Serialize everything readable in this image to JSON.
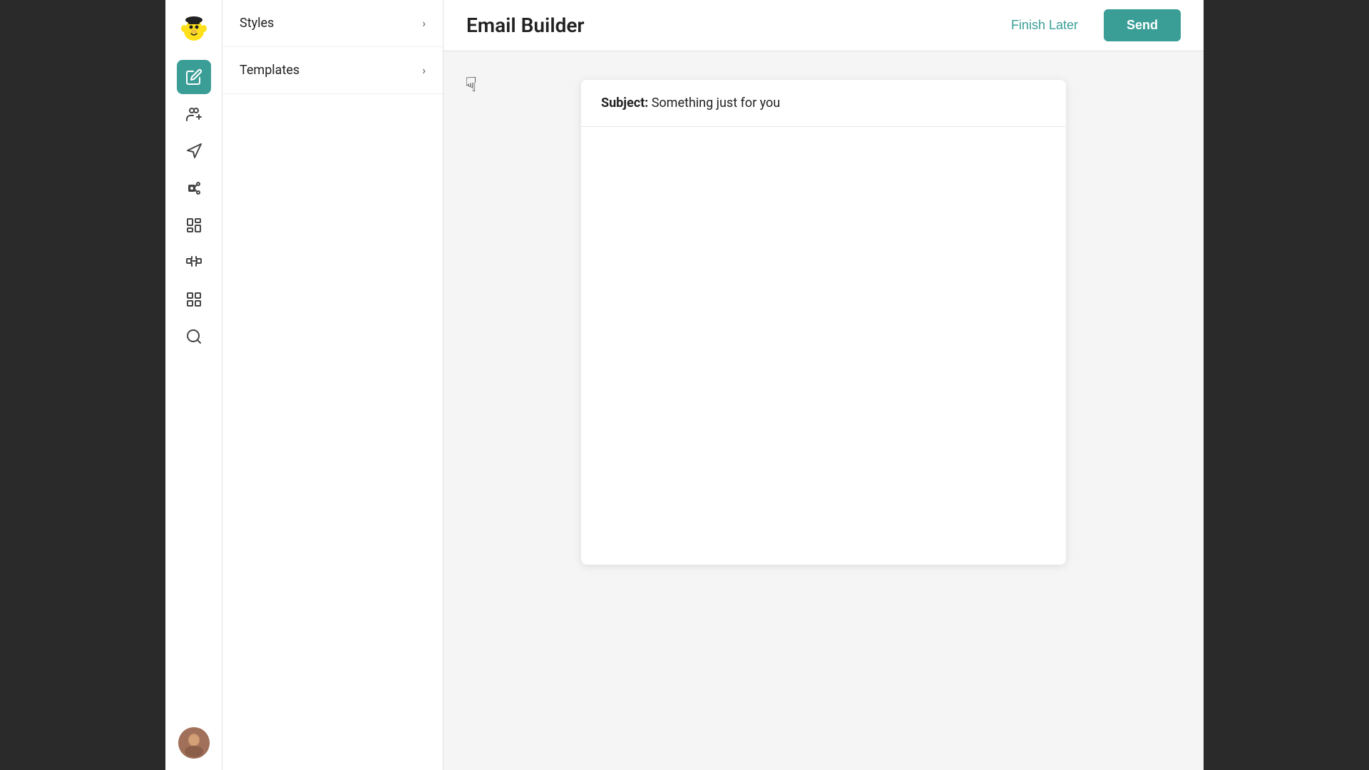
{
  "app": {
    "title": "Email Builder"
  },
  "header": {
    "finish_later_label": "Finish Later",
    "send_label": "Send"
  },
  "panel": {
    "styles_label": "Styles",
    "templates_label": "Templates"
  },
  "email": {
    "subject_label": "Subject:",
    "subject_text": "Something just for you"
  },
  "nav_icons": [
    {
      "name": "edit-icon",
      "label": "Edit",
      "active": true
    },
    {
      "name": "audience-icon",
      "label": "Audience",
      "active": false
    },
    {
      "name": "campaign-icon",
      "label": "Campaign",
      "active": false
    },
    {
      "name": "automation-icon",
      "label": "Automation",
      "active": false
    },
    {
      "name": "content-icon",
      "label": "Content",
      "active": false
    },
    {
      "name": "integrations-icon",
      "label": "Integrations",
      "active": false
    },
    {
      "name": "apps-icon",
      "label": "Apps",
      "active": false
    },
    {
      "name": "search-icon",
      "label": "Search",
      "active": false
    }
  ],
  "colors": {
    "accent": "#3a9e96",
    "active_bg": "#3a9e96",
    "border": "#e0e0e0"
  }
}
